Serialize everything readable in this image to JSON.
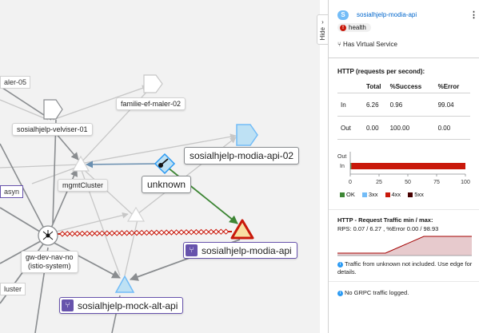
{
  "graph": {
    "nodes": {
      "maler_fragment": "aler-05",
      "famille": "familie-ef-maler-02",
      "velviser": "sosialhjelp-velviser-01",
      "modia_api_02": "sosialhjelp-modia-api-02",
      "unknown": "unknown",
      "mgmt_cluster": "mgmtCluster",
      "asyn_fragment": "asyn",
      "gateway_line1": "gw-dev-nav-no",
      "gateway_line2": "(istio-system)",
      "modia_api": "sosialhjelp-modia-api",
      "mock_alt_api": "sosialhjelp-mock-alt-api",
      "cluster_fragment": "luster"
    }
  },
  "hide_tab": {
    "label": "Hide"
  },
  "panel": {
    "service_badge": "S",
    "title": "sosialhjelp-modia-api",
    "kebab": "⋮",
    "health_label": "health",
    "virtual_service": "Has Virtual Service",
    "http_title": "HTTP (requests per second):",
    "table": {
      "headers": [
        "",
        "Total",
        "%Success",
        "%Error"
      ],
      "rows": [
        [
          "In",
          "6.26",
          "0.96",
          "99.04"
        ],
        [
          "Out",
          "0.00",
          "100.00",
          "0.00"
        ]
      ]
    },
    "bar": {
      "row_labels": [
        "Out",
        "In"
      ],
      "ticks": [
        "0",
        "25",
        "50",
        "75",
        "100"
      ],
      "in_values": {
        "ok": 0.96,
        "3xx": 0,
        "4xx": 99.04,
        "5xx": 0
      },
      "out_values": {
        "ok": 100,
        "3xx": 0,
        "4xx": 0,
        "5xx": 0
      }
    },
    "legend": [
      {
        "label": "OK",
        "color": "#3e8635"
      },
      {
        "label": "3xx",
        "color": "#73bcf7"
      },
      {
        "label": "4xx",
        "color": "#c9190b"
      },
      {
        "label": "5xx",
        "color": "#470000"
      }
    ],
    "traffic_title": "HTTP - Request Traffic min / max:",
    "rps_text": "RPS: 0.07 / 6.27 , %Error 0.00 / 98.93",
    "info_traffic": "Traffic from unknown not included. Use edge for details.",
    "info_grpc": "No GRPC traffic logged."
  }
}
